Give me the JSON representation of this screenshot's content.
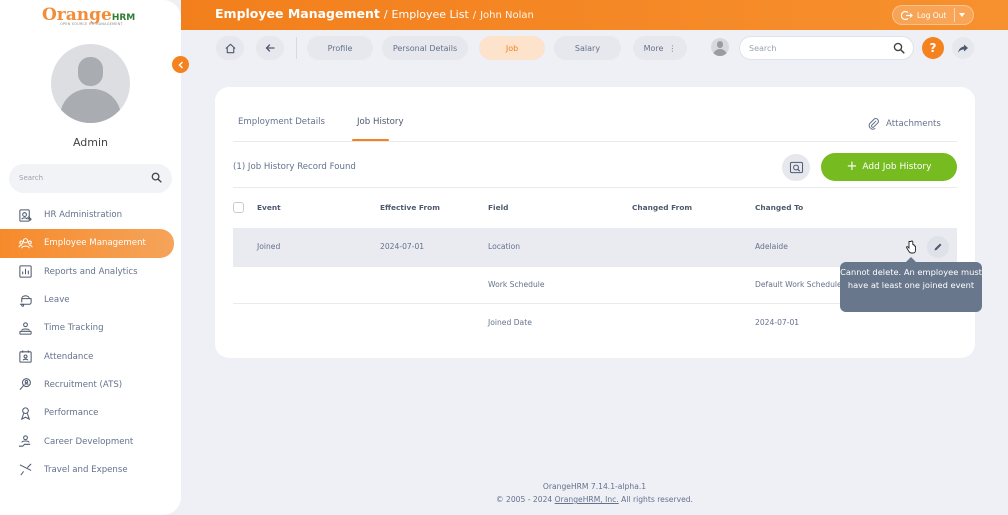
{
  "brand": {
    "name_orange": "Orange",
    "name_hrm": "HRM",
    "tagline": "OPEN SOURCE HR MANAGEMENT"
  },
  "user": {
    "display_name": "Admin"
  },
  "sidebar": {
    "search_placeholder": "Search",
    "items": [
      {
        "label": "HR Administration",
        "icon": "hr-admin-icon"
      },
      {
        "label": "Employee Management",
        "icon": "employee-management-icon",
        "active": true
      },
      {
        "label": "Reports and Analytics",
        "icon": "reports-icon"
      },
      {
        "label": "Leave",
        "icon": "leave-icon"
      },
      {
        "label": "Time Tracking",
        "icon": "time-tracking-icon"
      },
      {
        "label": "Attendance",
        "icon": "attendance-icon"
      },
      {
        "label": "Recruitment (ATS)",
        "icon": "recruitment-icon"
      },
      {
        "label": "Performance",
        "icon": "performance-icon"
      },
      {
        "label": "Career Development",
        "icon": "career-development-icon"
      },
      {
        "label": "Travel and Expense",
        "icon": "travel-icon"
      }
    ]
  },
  "header": {
    "module": "Employee Management",
    "separator": "/",
    "list": "Employee List",
    "separator2": "/",
    "employee": "John Nolan",
    "logout_label": "Log Out"
  },
  "subnav": {
    "tabs": [
      "Profile",
      "Personal Details",
      "Job",
      "Salary",
      "More"
    ],
    "more_icon": "⋮",
    "active_tab": "Job",
    "search_placeholder": "Search",
    "help_label": "?"
  },
  "card": {
    "tabs": [
      "Employment Details",
      "Job History"
    ],
    "active_tab": "Job History",
    "attachments_label": "Attachments",
    "records_found": "(1) Job History Record Found",
    "add_button_label": "Add Job History",
    "add_button_plus": "+",
    "columns": [
      "Event",
      "Effective From",
      "Field",
      "Changed From",
      "Changed To"
    ],
    "rows": [
      {
        "event": "Joined",
        "effective_from": "2024-07-01",
        "field": "Location",
        "changed_from": "",
        "changed_to": "Adelaide"
      },
      {
        "event": "",
        "effective_from": "",
        "field": "Work Schedule",
        "changed_from": "",
        "changed_to": "Default Work Schedule"
      },
      {
        "event": "",
        "effective_from": "",
        "field": "Joined Date",
        "changed_from": "",
        "changed_to": "2024-07-01"
      }
    ]
  },
  "tooltip": {
    "text": "Cannot delete. An employee must have at least one joined event"
  },
  "footer": {
    "version": "OrangeHRM 7.14.1-alpha.1",
    "copyright_prefix": "© 2005 - 2024",
    "company_link": "OrangeHRM, Inc.",
    "copyright_suffix": "All rights reserved."
  },
  "colors": {
    "accent": "#F5821F",
    "success": "#76BC21",
    "text": "#64728C",
    "background": "#EEF0F5"
  }
}
